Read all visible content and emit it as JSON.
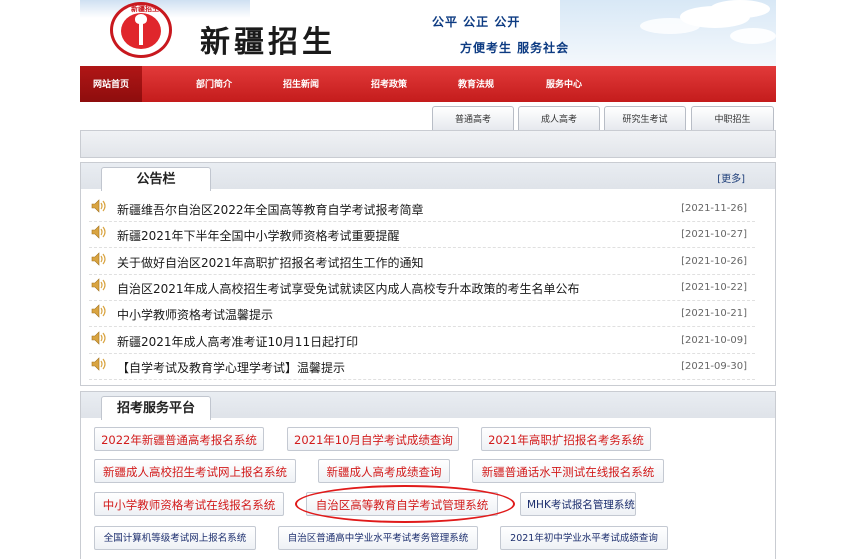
{
  "header": {
    "site_title": "新疆招生",
    "slogan_line1": "公平  公正  公开",
    "slogan_line2": "方便考生   服务社会",
    "logo_text": "新疆招生",
    "brand_color": "#c8181e"
  },
  "nav": {
    "items": [
      {
        "label": "网站首页",
        "active": true
      },
      {
        "label": "部门简介"
      },
      {
        "label": "招生新闻"
      },
      {
        "label": "招考政策"
      },
      {
        "label": "教育法规"
      },
      {
        "label": "服务中心"
      }
    ]
  },
  "subtabs": [
    "普通高考",
    "成人高考",
    "研究生考试",
    "中职招生"
  ],
  "notice_board": {
    "title": "公告栏",
    "more": "[更多]",
    "items": [
      {
        "text": "新疆维吾尔自治区2022年全国高等教育自学考试报考简章",
        "date": "[2021-11-26]"
      },
      {
        "text": "新疆2021年下半年全国中小学教师资格考试重要提醒",
        "date": "[2021-10-27]"
      },
      {
        "text": "关于做好自治区2021年高职扩招报名考试招生工作的通知",
        "date": "[2021-10-26]"
      },
      {
        "text": "自治区2021年成人高校招生考试享受免试就读区内成人高校专升本政策的考生名单公布",
        "date": "[2021-10-22]"
      },
      {
        "text": "中小学教师资格考试温馨提示",
        "date": "[2021-10-21]"
      },
      {
        "text": "新疆2021年成人高考准考证10月11日起打印",
        "date": "[2021-10-09]"
      },
      {
        "text": "【自学考试及教育学心理学考试】温馨提示",
        "date": "[2021-09-30]"
      }
    ]
  },
  "services": {
    "title": "招考服务平台",
    "row1": [
      "2022年新疆普通高考报名系统",
      "2021年10月自学考试成绩查询",
      "2021年高职扩招报名考务系统"
    ],
    "row2": [
      "新疆成人高校招生考试网上报名系统",
      "新疆成人高考成绩查询",
      "新疆普通话水平测试在线报名系统"
    ],
    "row3": [
      "中小学教师资格考试在线报名系统",
      "自治区高等教育自学考试管理系统",
      "MHK考试报名管理系统"
    ],
    "row4": [
      "全国计算机等级考试网上报名系统",
      "自治区普通高中学业水平考试考务管理系统",
      "2021年初中学业水平考试成绩查询"
    ],
    "highlight_color": "#e01a1a"
  }
}
